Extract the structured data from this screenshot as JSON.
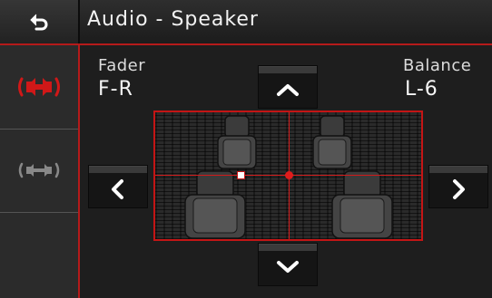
{
  "header": {
    "title": "Audio - Speaker",
    "back_icon": "back-arrow-icon"
  },
  "sidebar": {
    "items": [
      {
        "name": "speaker-balance",
        "icon": "speaker-active-icon",
        "selected": true
      },
      {
        "name": "speaker-setting",
        "icon": "speaker-inactive-icon",
        "selected": false
      }
    ]
  },
  "fader": {
    "label": "Fader",
    "value": "F-R"
  },
  "balance": {
    "label": "Balance",
    "value": "L-6"
  },
  "colors": {
    "accent": "#c41515",
    "background": "#1a1a1a"
  }
}
